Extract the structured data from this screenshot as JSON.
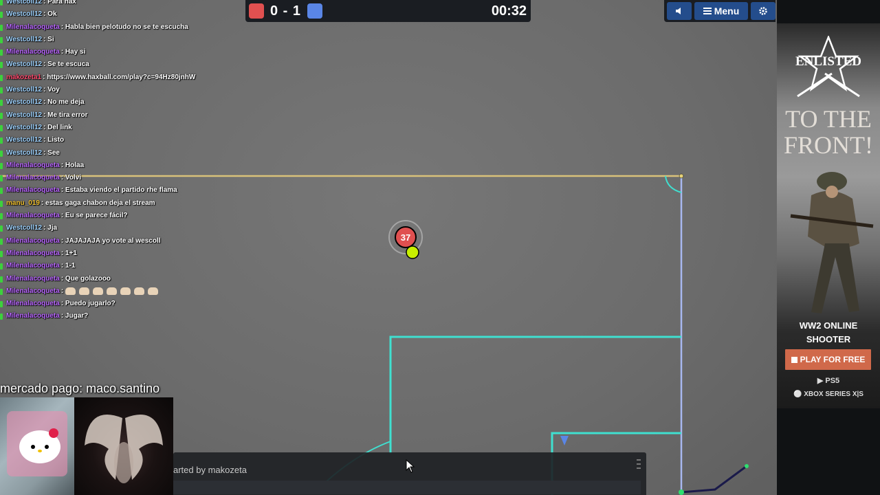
{
  "scoreboard": {
    "score": "0 - 1",
    "timer": "00:32",
    "red_color": "#e05050",
    "blue_color": "#5a86e6"
  },
  "controls": {
    "sound_icon": "speaker-icon",
    "menu_label": "Menu",
    "menu_icon": "hamburger-icon",
    "settings_icon": "gear-icon"
  },
  "game": {
    "player_number": "37",
    "player_color": "#e05050",
    "ball_color": "#c8f000",
    "line_color": "#3fe0d0"
  },
  "chat": [
    {
      "user": "Westcoll12",
      "text": "Para nax",
      "cls": "u-west"
    },
    {
      "user": "Westcoll12",
      "text": "Ok",
      "cls": "u-west"
    },
    {
      "user": "Milenalacoqueta",
      "text": "Habla bien pelotudo no se te escucha",
      "cls": "u-mile"
    },
    {
      "user": "Westcoll12",
      "text": "Si",
      "cls": "u-west"
    },
    {
      "user": "Milenalacoqueta",
      "text": "Hay si",
      "cls": "u-mile"
    },
    {
      "user": "Westcoll12",
      "text": "Se te escuca",
      "cls": "u-west"
    },
    {
      "user": "makozeta1",
      "text": "https://www.haxball.com/play?c=94Hz80jnhW",
      "cls": "u-mako"
    },
    {
      "user": "Westcoll12",
      "text": "Voy",
      "cls": "u-west"
    },
    {
      "user": "Westcoll12",
      "text": "No me deja",
      "cls": "u-west"
    },
    {
      "user": "Westcoll12",
      "text": "Me tira error",
      "cls": "u-west"
    },
    {
      "user": "Westcoll12",
      "text": "Del link",
      "cls": "u-west"
    },
    {
      "user": "Westcoll12",
      "text": "Listo",
      "cls": "u-west"
    },
    {
      "user": "Westcoll12",
      "text": "See",
      "cls": "u-west"
    },
    {
      "user": "Milenalacoqueta",
      "text": "Holaa",
      "cls": "u-mile"
    },
    {
      "user": "Milenalacoqueta",
      "text": "Volvi",
      "cls": "u-mile"
    },
    {
      "user": "Milenalacoqueta",
      "text": "Estaba viendo el partido rhe flama",
      "cls": "u-mile"
    },
    {
      "user": "manu_019",
      "text": "estas gaga chabon deja el stream",
      "cls": "u-manu"
    },
    {
      "user": "Milenalacoqueta",
      "text": "Eu se parece fácil?",
      "cls": "u-mile"
    },
    {
      "user": "Westcoll12",
      "text": "Jja",
      "cls": "u-west"
    },
    {
      "user": "Milenalacoqueta",
      "text": "JAJAJAJA yo vote al wescoll",
      "cls": "u-mile"
    },
    {
      "user": "Milenalacoqueta",
      "text": "1+1",
      "cls": "u-mile"
    },
    {
      "user": "Milenalacoqueta",
      "text": "1-1",
      "cls": "u-mile"
    },
    {
      "user": "Milenalacoqueta",
      "text": "Que golazooo",
      "cls": "u-mile"
    },
    {
      "user": "Milenalacoqueta",
      "text": "",
      "cls": "u-mile",
      "emoji_count": 7
    },
    {
      "user": "Milenalacoqueta",
      "text": "Puedo jugarlo?",
      "cls": "u-mile"
    },
    {
      "user": "Milenalacoqueta",
      "text": "Jugar?",
      "cls": "u-mile"
    }
  ],
  "overlay": {
    "donation": "mercado pago: maco.santino"
  },
  "chatbar": {
    "notice": "arted by makozeta",
    "input_value": ""
  },
  "ad": {
    "brand": "ENLISTED",
    "headline_1": "TO THE",
    "headline_2": "FRONT!",
    "tagline_1": "WW2 ONLINE",
    "tagline_2": "SHOOTER",
    "cta": "PLAY FOR FREE",
    "platform_1": "PS5",
    "platform_2": "XBOX SERIES X|S",
    "cta_color": "#d0694a"
  }
}
